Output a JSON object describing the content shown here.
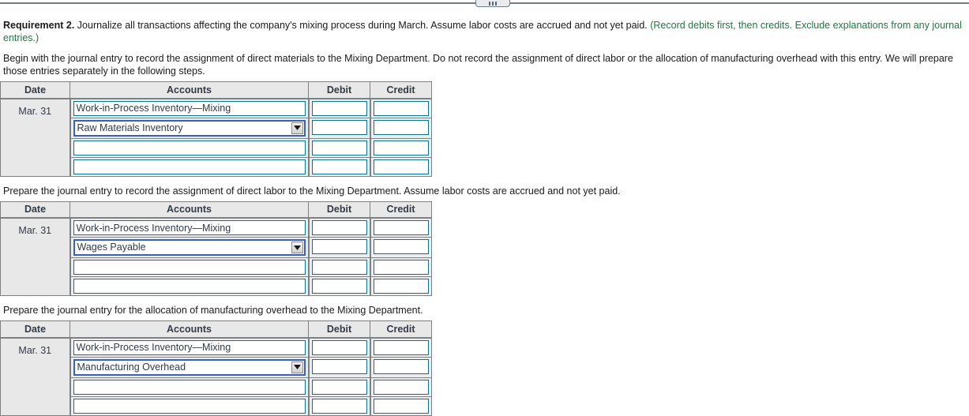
{
  "splitter": {
    "grip_name": "panel-resize-grip"
  },
  "requirement": {
    "label": "Requirement 2.",
    "text": " Journalize all transactions affecting the company's mixing process during March. Assume labor costs are accrued and not yet paid. ",
    "hint": "(Record debits first, then credits. Exclude explanations from any journal entries.)"
  },
  "intro": "Begin with the journal entry to record the assignment of direct materials to the Mixing Department. Do not record the assignment of direct labor or the allocation of manufacturing overhead with this entry. We will prepare those entries separately in the following steps.",
  "columns": {
    "date": "Date",
    "accounts": "Accounts",
    "debit": "Debit",
    "credit": "Credit"
  },
  "entries": [
    {
      "prompt": "",
      "date": "Mar. 31",
      "rows": [
        {
          "type": "text",
          "account": "Work-in-Process Inventory—Mixing",
          "debit": "",
          "credit": ""
        },
        {
          "type": "select",
          "account": "Raw Materials Inventory",
          "debit": "",
          "credit": ""
        },
        {
          "type": "text",
          "account": "",
          "debit": "",
          "credit": ""
        },
        {
          "type": "text",
          "account": "",
          "debit": "",
          "credit": ""
        }
      ]
    },
    {
      "prompt": "Prepare the journal entry to record the assignment of direct labor to the Mixing Department. Assume labor costs are accrued and not yet paid.",
      "date": "Mar. 31",
      "rows": [
        {
          "type": "text",
          "account": "Work-in-Process Inventory—Mixing",
          "debit": "",
          "credit": ""
        },
        {
          "type": "select",
          "account": "Wages Payable",
          "debit": "",
          "credit": ""
        },
        {
          "type": "text",
          "account": "",
          "debit": "",
          "credit": ""
        },
        {
          "type": "text",
          "account": "",
          "debit": "",
          "credit": ""
        }
      ]
    },
    {
      "prompt": "Prepare the journal entry for the allocation of manufacturing overhead to the Mixing Department.",
      "date": "Mar. 31",
      "rows": [
        {
          "type": "text",
          "account": "Work-in-Process Inventory—Mixing",
          "debit": "",
          "credit": ""
        },
        {
          "type": "select",
          "account": "Manufacturing Overhead",
          "debit": "",
          "credit": ""
        },
        {
          "type": "text",
          "account": "",
          "debit": "",
          "credit": ""
        },
        {
          "type": "text",
          "account": "",
          "debit": "",
          "credit": ""
        }
      ]
    }
  ],
  "colors": {
    "input_border": "#0d7490",
    "select_focus_border": "#3b5fc0",
    "hint_text": "#1f7a3f",
    "header_bg": "#e8e8e8",
    "table_bg": "#e9eef2",
    "splitter": "#707b8c"
  }
}
